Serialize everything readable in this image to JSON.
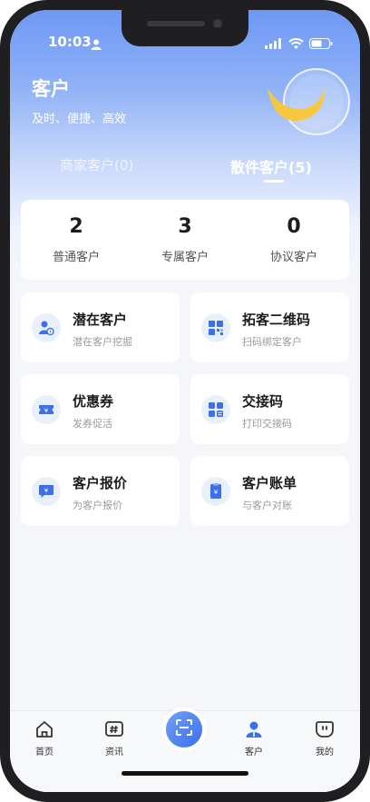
{
  "status_bar": {
    "time": "10:03"
  },
  "header": {
    "title": "客户",
    "subtitle": "及时、便捷、高效"
  },
  "tabs": [
    {
      "label": "商家客户(0)",
      "active": false
    },
    {
      "label": "散件客户(5)",
      "active": true
    }
  ],
  "stats": [
    {
      "value": "2",
      "label": "普通客户"
    },
    {
      "value": "3",
      "label": "专属客户"
    },
    {
      "value": "0",
      "label": "协议客户"
    }
  ],
  "cards": [
    {
      "title": "潜在客户",
      "subtitle": "潜在客户挖掘",
      "icon": "user-search-icon"
    },
    {
      "title": "拓客二维码",
      "subtitle": "扫码绑定客户",
      "icon": "qr-code-icon"
    },
    {
      "title": "优惠券",
      "subtitle": "发券促活",
      "icon": "coupon-icon"
    },
    {
      "title": "交接码",
      "subtitle": "打印交接码",
      "icon": "handover-code-icon"
    },
    {
      "title": "客户报价",
      "subtitle": "为客户报价",
      "icon": "quote-icon"
    },
    {
      "title": "客户账单",
      "subtitle": "与客户对账",
      "icon": "bill-icon"
    }
  ],
  "bottom_nav": [
    {
      "label": "首页",
      "icon": "home-icon"
    },
    {
      "label": "资讯",
      "icon": "news-icon"
    },
    {
      "label": "",
      "icon": "scan-icon"
    },
    {
      "label": "客户",
      "icon": "customer-icon",
      "active": true
    },
    {
      "label": "我的",
      "icon": "profile-icon"
    }
  ],
  "colors": {
    "accent": "#3d70e8",
    "hero_top": "#6e98f5",
    "background": "#f4f6f9"
  }
}
